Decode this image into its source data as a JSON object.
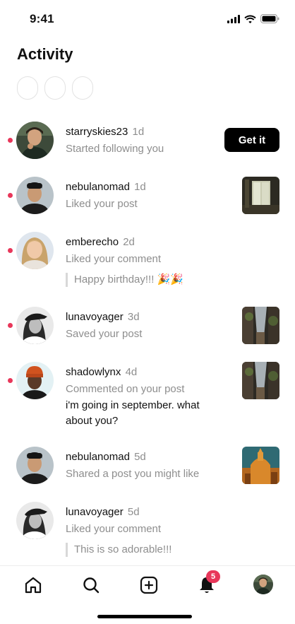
{
  "status_bar": {
    "time": "9:41"
  },
  "header": {
    "title": "Activity"
  },
  "activity": [
    {
      "username": "starryskies23",
      "age": "1d",
      "action": "Started following you",
      "button_label": "Get it",
      "unread": true
    },
    {
      "username": "nebulanomad",
      "age": "1d",
      "action": "Liked your post",
      "unread": true
    },
    {
      "username": "emberecho",
      "age": "2d",
      "action": "Liked your comment",
      "quote": "Happy birthday!!! 🎉🎉",
      "unread": true
    },
    {
      "username": "lunavoyager",
      "age": "3d",
      "action": "Saved your post",
      "unread": true
    },
    {
      "username": "shadowlynx",
      "age": "4d",
      "action": "Commented on your post",
      "comment": "i'm going in september. what about you?",
      "unread": true
    },
    {
      "username": "nebulanomad",
      "age": "5d",
      "action": "Shared a post you might like",
      "unread": false
    },
    {
      "username": "lunavoyager",
      "age": "5d",
      "action": "Liked your comment",
      "quote": "This is so adorable!!!",
      "unread": false
    }
  ],
  "tab_bar": {
    "tabs": [
      {
        "icon": "home-icon"
      },
      {
        "icon": "search-icon"
      },
      {
        "icon": "add-post-icon"
      },
      {
        "icon": "bell-icon",
        "badge": "5"
      },
      {
        "icon": "profile-avatar"
      }
    ]
  },
  "colors": {
    "accent": "#e8375a",
    "button": "#000000",
    "muted_text": "#8e8e8e"
  }
}
